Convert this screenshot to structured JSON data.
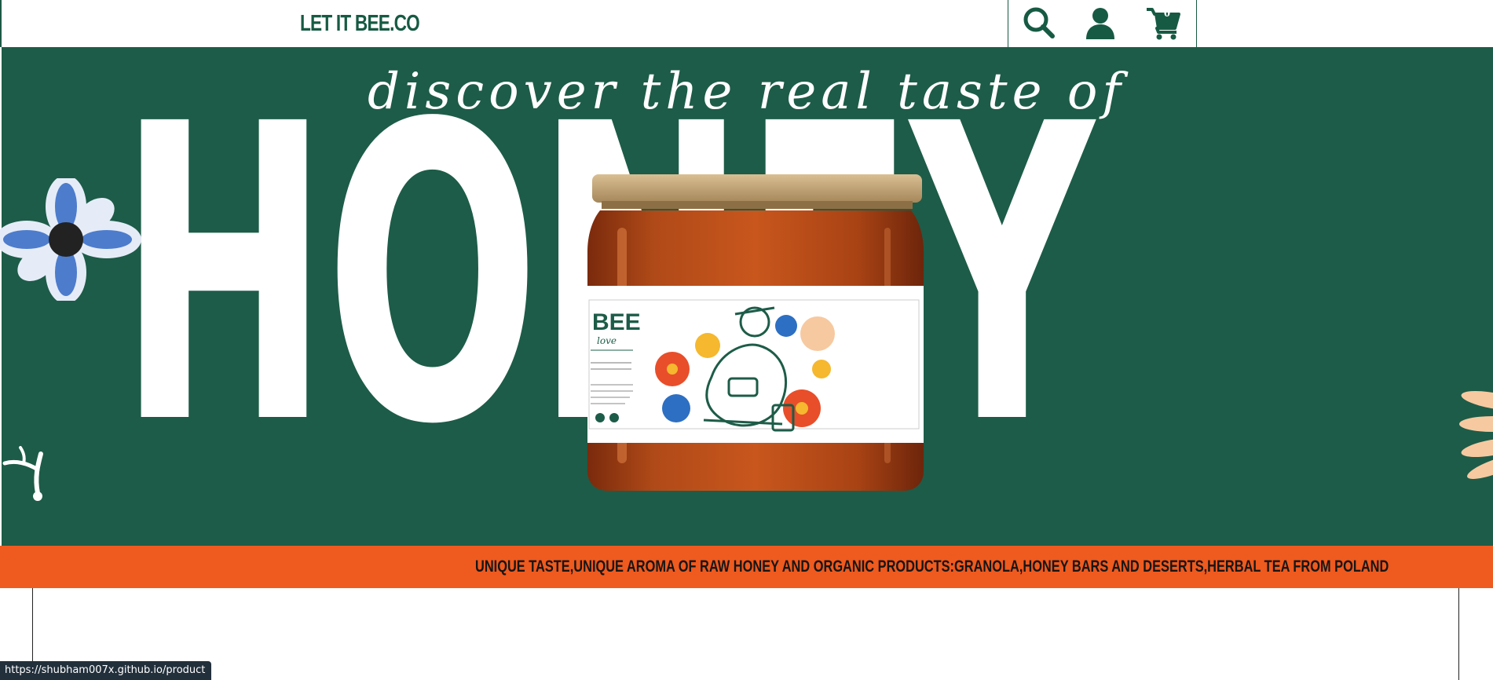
{
  "header": {
    "logo": "LET IT BEE.CO",
    "icons": [
      "search-icon",
      "user-icon",
      "cart-icon"
    ],
    "cart_count": "0"
  },
  "hero": {
    "tagline": "discover the real taste of",
    "headline": "HONEY"
  },
  "strip": {
    "text": "UNIQUE TASTE,UNIQUE AROMA OF RAW HONEY AND ORGANIC PRODUCTS:GRANOLA,HONEY BARS AND DESERTS,HERBAL TEA FROM POLAND"
  },
  "status_bar": {
    "url": "https://shubham007x.github.io/product"
  },
  "colors": {
    "brand_green": "#1d5c48",
    "accent_orange": "#ef5a1f",
    "text_dark": "#161616"
  }
}
